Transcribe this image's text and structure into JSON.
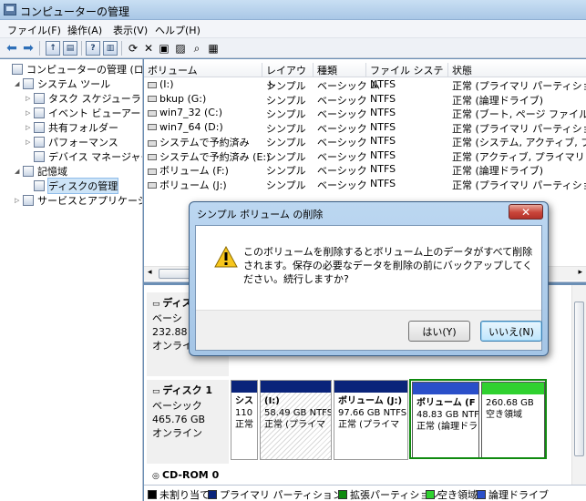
{
  "window": {
    "title": "コンピューターの管理"
  },
  "menu": [
    "ファイル(F)",
    "操作(A)",
    "表示(V)",
    "ヘルプ(H)"
  ],
  "tree": [
    {
      "label": "コンピューターの管理 (ロー力",
      "level": 0,
      "expander": ""
    },
    {
      "label": "システム ツール",
      "level": 1,
      "expander": "◢"
    },
    {
      "label": "タスク スケジューラ",
      "level": 2,
      "expander": "▷"
    },
    {
      "label": "イベント ビューアー",
      "level": 2,
      "expander": "▷"
    },
    {
      "label": "共有フォルダー",
      "level": 2,
      "expander": "▷"
    },
    {
      "label": "パフォーマンス",
      "level": 2,
      "expander": "▷"
    },
    {
      "label": "デバイス マネージャー",
      "level": 2,
      "expander": ""
    },
    {
      "label": "記憶域",
      "level": 1,
      "expander": "◢"
    },
    {
      "label": "ディスクの管理",
      "level": 2,
      "expander": "",
      "selected": true
    },
    {
      "label": "サービスとアプリケーショ",
      "level": 1,
      "expander": "▷"
    }
  ],
  "columns": [
    "ボリューム",
    "レイアウト",
    "種類",
    "ファイル システム",
    "状態"
  ],
  "volumes": [
    {
      "name": "(I:)",
      "layout": "シンプル",
      "type": "ベーシック",
      "fs": "NTFS",
      "status": "正常 (プライマリ パーティション"
    },
    {
      "name": "bkup (G:)",
      "layout": "シンプル",
      "type": "ベーシック",
      "fs": "NTFS",
      "status": "正常 (論理ドライブ)"
    },
    {
      "name": "win7_32 (C:)",
      "layout": "シンプル",
      "type": "ベーシック",
      "fs": "NTFS",
      "status": "正常 (ブート, ページ ファイル,"
    },
    {
      "name": "win7_64 (D:)",
      "layout": "シンプル",
      "type": "ベーシック",
      "fs": "NTFS",
      "status": "正常 (プライマリ パーティション"
    },
    {
      "name": "システムで予約済み",
      "layout": "シンプル",
      "type": "ベーシック",
      "fs": "NTFS",
      "status": "正常 (システム, アクティブ, プ"
    },
    {
      "name": "システムで予約済み (E:)",
      "layout": "シンプル",
      "type": "ベーシック",
      "fs": "NTFS",
      "status": "正常 (アクティブ, プライマリ パ"
    },
    {
      "name": "ボリューム (F:)",
      "layout": "シンプル",
      "type": "ベーシック",
      "fs": "NTFS",
      "status": "正常 (論理ドライブ)"
    },
    {
      "name": "ボリューム (J:)",
      "layout": "シンプル",
      "type": "ベーシック",
      "fs": "NTFS",
      "status": "正常 (プライマリ パーティション"
    }
  ],
  "disk0": {
    "name": "ディス",
    "type": "ベーシ",
    "size": "232.88 G",
    "status": "オンライ"
  },
  "disk1": {
    "name": "ディスク 1",
    "type": "ベーシック",
    "size": "465.76 GB",
    "status": "オンライン",
    "parts": [
      {
        "title": "シス",
        "line2": "110",
        "line3": "正常"
      },
      {
        "title": "(I:)",
        "line2": "58.49 GB NTFS",
        "line3": "正常 (プライマ"
      },
      {
        "title": "ボリューム (J:)",
        "line2": "97.66 GB NTFS",
        "line3": "正常 (プライマ"
      },
      {
        "title": "ボリューム (F",
        "line2": "48.83 GB NTF",
        "line3": "正常 (論理ドラ"
      },
      {
        "title": "",
        "line2": "260.68 GB",
        "line3": "空き領域"
      }
    ]
  },
  "cdrom": {
    "name": "CD-ROM 0"
  },
  "legend": [
    {
      "label": "未割り当て",
      "color": "#000000"
    },
    {
      "label": "プライマリ パーティション",
      "color": "#0a247a"
    },
    {
      "label": "拡張パーティション",
      "color": "#0f8a0f"
    },
    {
      "label": "空き領域",
      "color": "#2fd12f"
    },
    {
      "label": "論理ドライブ",
      "color": "#2a4fc9"
    }
  ],
  "dialog": {
    "title": "シンプル ボリューム の削除",
    "message": "このボリュームを削除するとボリューム上のデータがすべて削除されます。保存の必要なデータを削除の前にバックアップしてください。続行しますか?",
    "yes": "はい(Y)",
    "no": "いいえ(N)"
  }
}
